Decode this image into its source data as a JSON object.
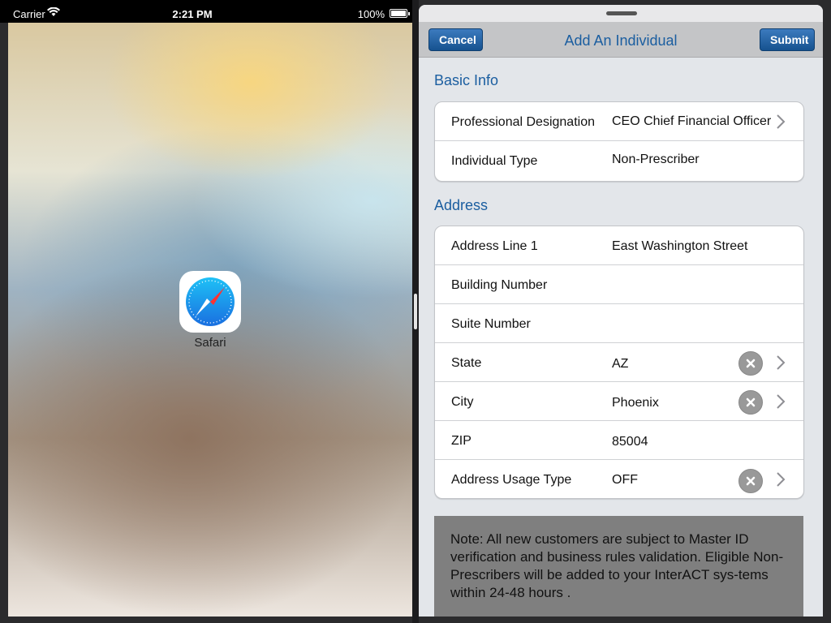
{
  "status_bar": {
    "carrier": "Carrier",
    "time": "2:21 PM",
    "battery": "100%"
  },
  "left_pane": {
    "app_label": "Safari",
    "app_icon": "safari-compass-icon"
  },
  "right_pane": {
    "nav": {
      "cancel": "Cancel",
      "title": "Add An Individual",
      "submit": "Submit"
    },
    "basic_info": {
      "title": "Basic Info",
      "rows": [
        {
          "label": "Professional Designation",
          "value": "CEO Chief Financial Officer"
        },
        {
          "label": "Individual Type",
          "value": "Non-Prescriber"
        }
      ]
    },
    "address": {
      "title": "Address",
      "rows": [
        {
          "label": "Address Line 1",
          "value": "East Washington Street"
        },
        {
          "label": "Building Number",
          "value": ""
        },
        {
          "label": "Suite Number",
          "value": ""
        },
        {
          "label": "State",
          "value": "AZ"
        },
        {
          "label": "City",
          "value": "Phoenix"
        },
        {
          "label": "ZIP",
          "value": "85004"
        },
        {
          "label": "Address Usage Type",
          "value": "OFF"
        }
      ]
    },
    "note": "Note: All new customers are subject to Master ID verification and business rules validation. Eligible Non-Prescribers will be added to your InterACT sys-tems within 24-48 hours ."
  },
  "colors": {
    "accent": "#1b5ea0",
    "nav_button": "#16528f",
    "note_background": "#7f7f7f"
  }
}
